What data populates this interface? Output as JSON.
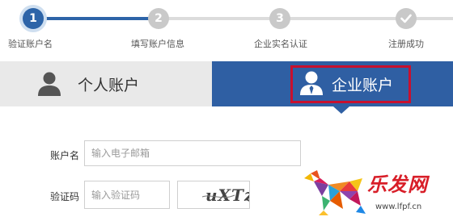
{
  "steps": [
    {
      "number": "1",
      "label": "验证账户名",
      "state": "active"
    },
    {
      "number": "2",
      "label": "填写账户信息",
      "state": "pending"
    },
    {
      "number": "3",
      "label": "企业实名认证",
      "state": "pending"
    },
    {
      "number": "",
      "label": "注册成功",
      "state": "pending",
      "icon": "check-icon"
    }
  ],
  "tabs": {
    "personal": {
      "label": "个人账户",
      "icon": "person-icon",
      "selected": false
    },
    "company": {
      "label": "企业账户",
      "icon": "business-person-icon",
      "selected": true
    }
  },
  "form": {
    "account": {
      "label": "账户名",
      "placeholder": "输入电子邮箱",
      "value": ""
    },
    "captcha": {
      "label": "验证码",
      "placeholder": "输入验证码",
      "value": "",
      "image_text": "uXTz"
    }
  },
  "watermark": {
    "brand": "乐发网",
    "url": "www.lfpf.cn"
  },
  "colors": {
    "primary": "#2f5fa3",
    "highlight": "#c8102e",
    "pending": "#c9c9c9",
    "tab_inactive": "#e9e9e9"
  }
}
